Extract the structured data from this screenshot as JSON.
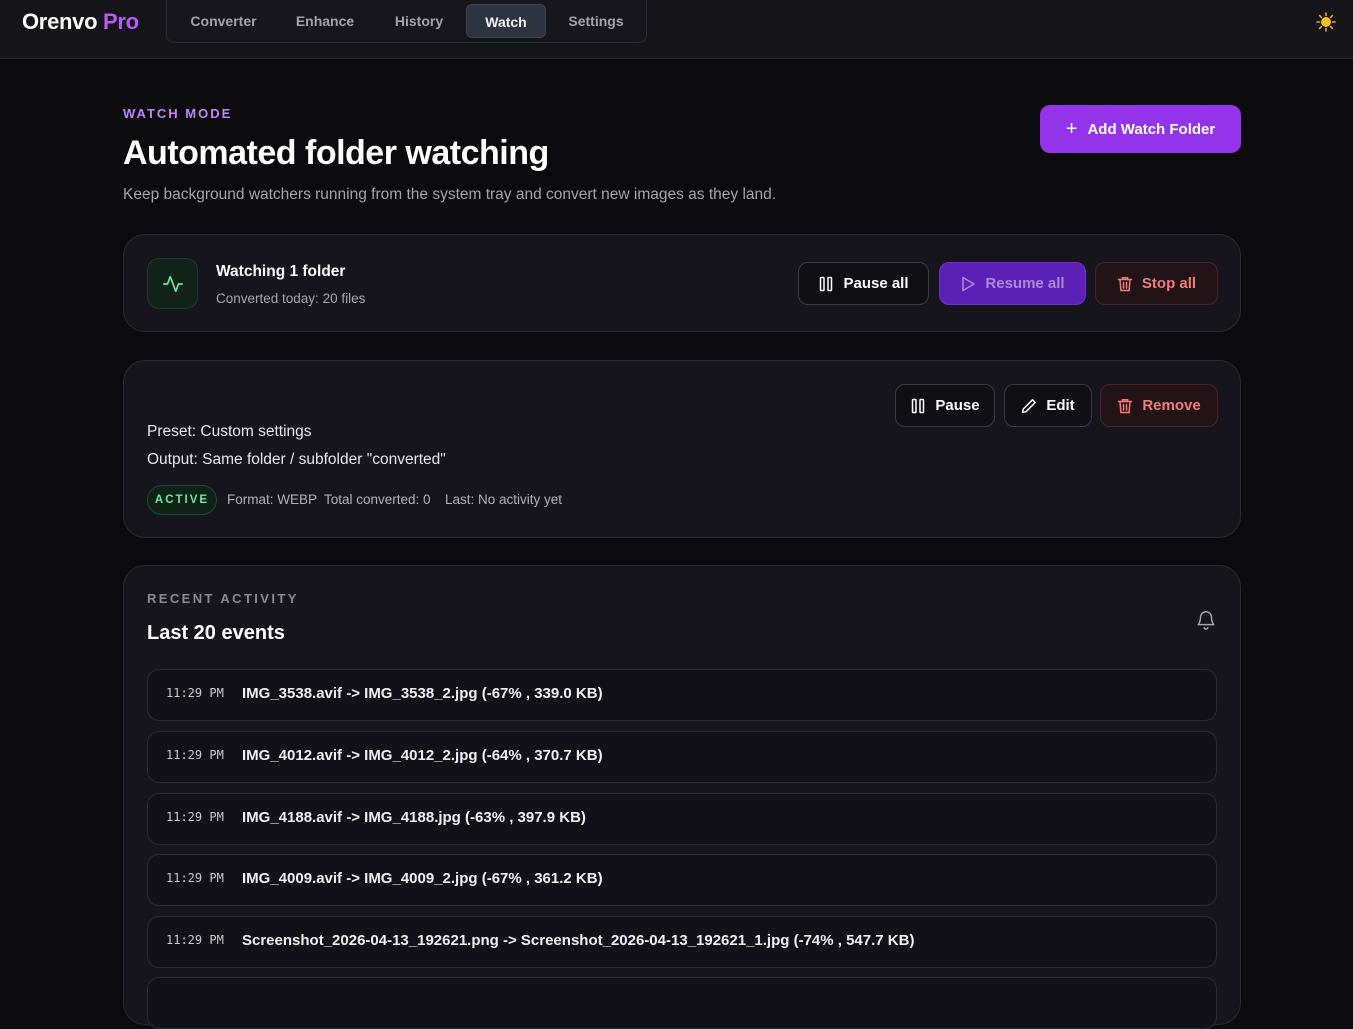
{
  "brand": {
    "name": "Orenvo",
    "tier": "Pro"
  },
  "nav": {
    "tabs": [
      {
        "label": "Converter"
      },
      {
        "label": "Enhance"
      },
      {
        "label": "History"
      },
      {
        "label": "Watch"
      },
      {
        "label": "Settings"
      }
    ],
    "active": "Watch"
  },
  "header": {
    "eyebrow": "WATCH MODE",
    "title": "Automated folder watching",
    "subtitle": "Keep background watchers running from the system tray and convert new images as they land.",
    "add_label": "Add Watch Folder"
  },
  "status": {
    "title": "Watching 1 folder",
    "subtitle": "Converted today: 20 files",
    "pause_all": "Pause all",
    "resume_all": "Resume all",
    "stop_all": "Stop all"
  },
  "folder": {
    "preset": "Preset: Custom settings",
    "output": "Output: Same folder / subfolder \"converted\"",
    "badge": "ACTIVE",
    "format": "Format: WEBP",
    "total": "Total converted: 0",
    "last": "Last: No activity yet",
    "pause": "Pause",
    "edit": "Edit",
    "remove": "Remove"
  },
  "activity": {
    "eyebrow": "RECENT ACTIVITY",
    "title": "Last 20 events",
    "events": [
      {
        "time": "11:29 PM",
        "text": "IMG_3538.avif -> IMG_3538_2.jpg (-67% , 339.0 KB)"
      },
      {
        "time": "11:29 PM",
        "text": "IMG_4012.avif -> IMG_4012_2.jpg (-64% , 370.7 KB)"
      },
      {
        "time": "11:29 PM",
        "text": "IMG_4188.avif -> IMG_4188.jpg (-63% , 397.9 KB)"
      },
      {
        "time": "11:29 PM",
        "text": "IMG_4009.avif -> IMG_4009_2.jpg (-67% , 361.2 KB)"
      },
      {
        "time": "11:29 PM",
        "text": "Screenshot_2026-04-13_192621.png -> Screenshot_2026-04-13_192621_1.jpg (-74% , 547.7 KB)"
      }
    ]
  },
  "colors": {
    "accent": "#9333ea",
    "brand_pro": "#b65cf5",
    "active_green": "#6ee7a0",
    "danger": "#f07c7c"
  },
  "icons": {
    "theme": "sun-icon",
    "add": "plus-icon",
    "pulse": "activity-pulse-icon",
    "pause": "pause-icon",
    "resume": "play-icon",
    "stop": "trash-icon",
    "edit": "pencil-icon",
    "notifications": "bell-icon"
  }
}
